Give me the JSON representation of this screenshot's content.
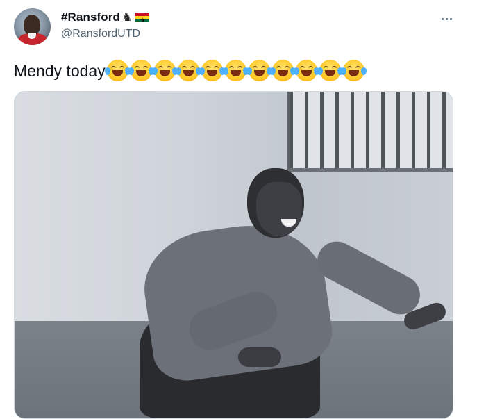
{
  "tweet": {
    "author": {
      "display_name": "#Ransford",
      "handle": "@RansfordUTD",
      "name_badges": [
        "horse-icon",
        "ghana-flag-icon"
      ]
    },
    "text": "Mendy today",
    "emoji_count": 11,
    "emoji": "face-with-tears-of-joy"
  },
  "colors": {
    "text_primary": "#0f1419",
    "text_secondary": "#536471",
    "border": "#cfd9de"
  }
}
